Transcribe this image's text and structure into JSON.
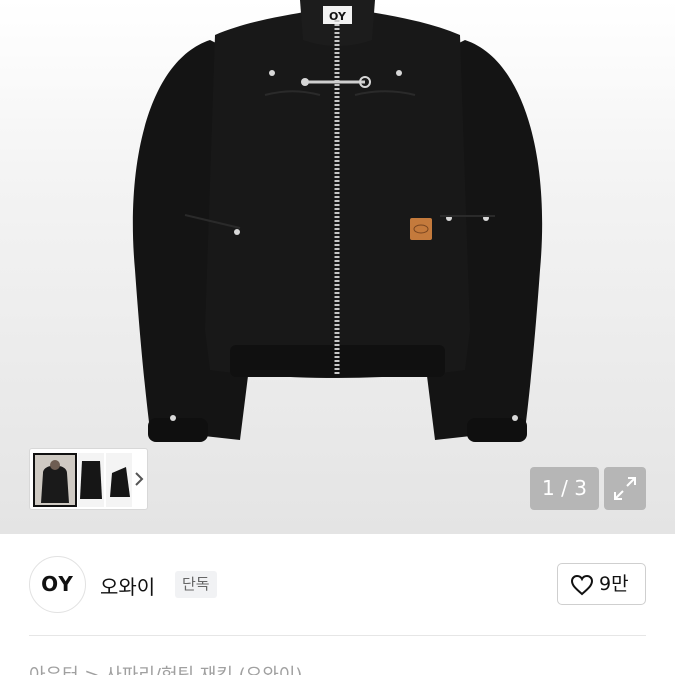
{
  "product_image": {
    "jacket_color": "#151515",
    "zipper_color": "#c8c8c8",
    "tag_color": "#c47a3c",
    "hood_logo": "OY"
  },
  "gallery": {
    "counter": "1 / 3",
    "next_icon": "chevron-right-icon",
    "expand_icon": "expand-icon"
  },
  "brand": {
    "logo_text": "OY",
    "name": "오와이",
    "badge": "단독"
  },
  "like": {
    "icon": "heart-outline-icon",
    "count": "9만"
  },
  "breadcrumb": {
    "text": "아우터 > 사파리/헌팅 재킷 (오와이)"
  }
}
